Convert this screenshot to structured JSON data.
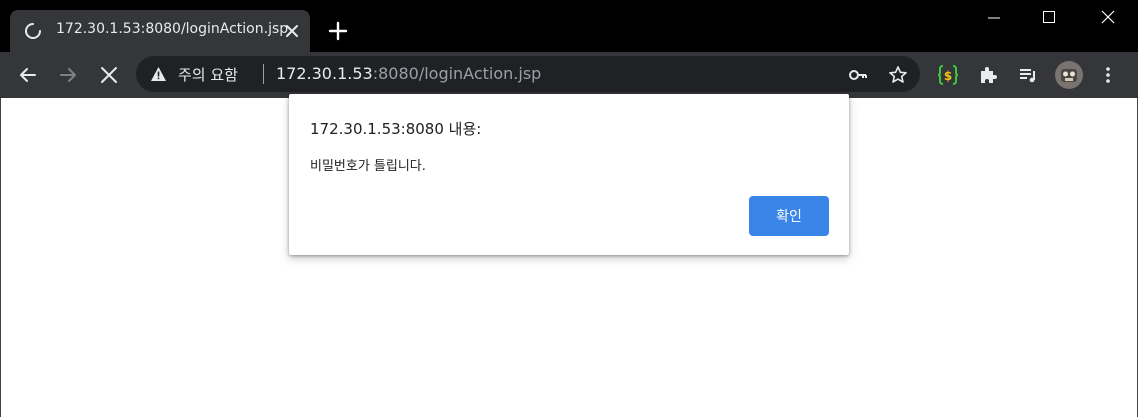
{
  "tab": {
    "title": "172.30.1.53:8080/loginAction.jsp",
    "close_icon": "close-icon",
    "loading_icon": "spinner-icon"
  },
  "new_tab_icon": "plus-icon",
  "window_controls": [
    "minimize-icon",
    "maximize-icon",
    "close-icon"
  ],
  "toolbar": {
    "back_icon": "arrow-left-icon",
    "forward_icon": "arrow-right-icon",
    "stop_icon": "close-icon",
    "security_warning": "주의 요함",
    "url_host": "172.30.1.53",
    "url_rest": ":8080/loginAction.jsp",
    "right_icons": [
      "key-icon",
      "star-icon",
      "extension-brackets-icon",
      "puzzle-icon",
      "media-queue-icon",
      "avatar",
      "kebab-menu-icon"
    ]
  },
  "dialog": {
    "title": "172.30.1.53:8080 내용:",
    "message": "비밀번호가 틀립니다.",
    "ok_label": "확인"
  },
  "colors": {
    "titlebar": "#000000",
    "toolbar": "#35363a",
    "omnibox": "#202124",
    "ok_button": "#3a86e8",
    "extension_green": "#3cc63c",
    "extension_yellow": "#f5c518"
  }
}
